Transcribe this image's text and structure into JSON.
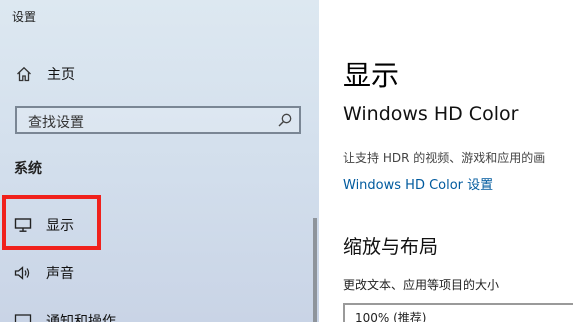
{
  "app": {
    "title": "设置"
  },
  "nav": {
    "home_label": "主页",
    "search_placeholder": "查找设置",
    "section_label": "系统",
    "items": [
      {
        "label": "显示",
        "icon": "monitor-icon",
        "selected": true
      },
      {
        "label": "声音",
        "icon": "speaker-icon"
      },
      {
        "label": "通知和操作",
        "icon": "notification-icon"
      }
    ]
  },
  "content": {
    "title": "显示",
    "hd_color": {
      "heading": "Windows HD Color",
      "description": "让支持 HDR 的视频、游戏和应用的画",
      "link": "Windows HD Color 设置"
    },
    "scale_layout": {
      "heading": "缩放与布局",
      "field_label": "更改文本、应用等项目的大小",
      "selected_value": "100% (推荐)"
    }
  },
  "colors": {
    "accent_link": "#005a9e",
    "highlight_box": "#f0211c"
  }
}
